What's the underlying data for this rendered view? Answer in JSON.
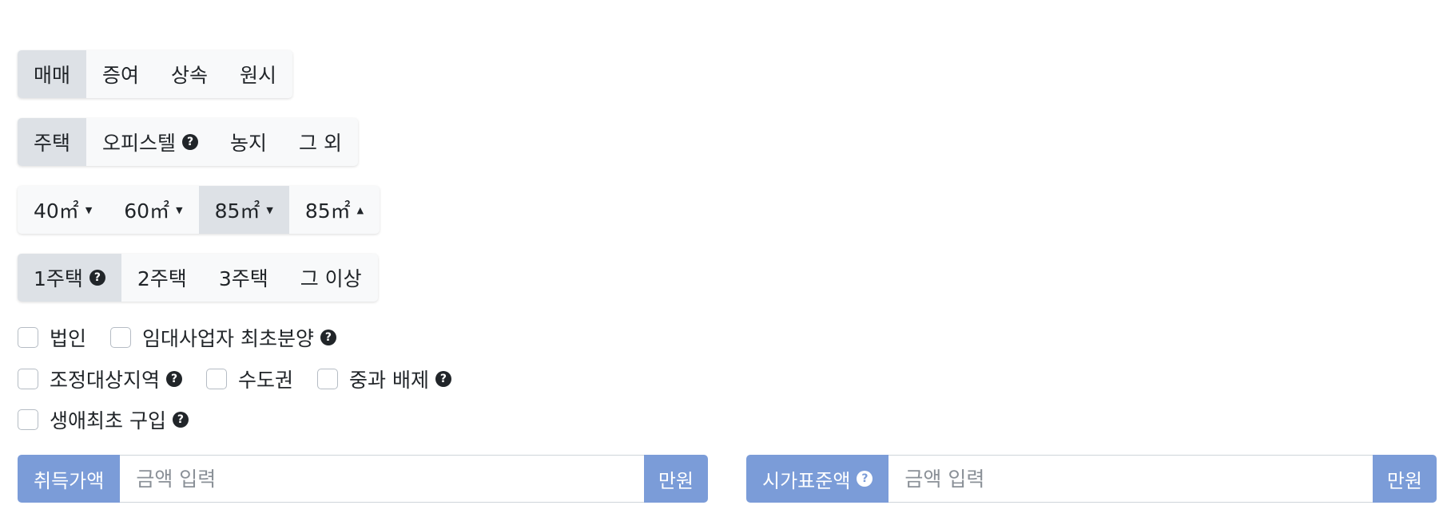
{
  "trade_types": [
    "매매",
    "증여",
    "상속",
    "원시"
  ],
  "property_types": [
    "주택",
    "오피스텔",
    "농지",
    "그 외"
  ],
  "areas": [
    {
      "label": "40㎡",
      "caret": "▼"
    },
    {
      "label": "60㎡",
      "caret": "▼"
    },
    {
      "label": "85㎡",
      "caret": "▼"
    },
    {
      "label": "85㎡",
      "caret": "▲"
    }
  ],
  "house_counts": [
    "1주택",
    "2주택",
    "3주택",
    "그 이상"
  ],
  "checkboxes": {
    "corporation": "법인",
    "rental_first_sale": "임대사업자 최초분양",
    "regulated_area": "조정대상지역",
    "capital_area": "수도권",
    "exclude_surcharge": "중과 배제",
    "first_purchase": "생애최초 구입"
  },
  "help_icon_glyph": "?",
  "acquisition": {
    "label": "취득가액",
    "placeholder": "금액 입력",
    "unit": "만원"
  },
  "standard_price": {
    "label": "시가표준액",
    "placeholder": "금액 입력",
    "unit": "만원"
  },
  "colors": {
    "accent": "#7b9cd8",
    "active_segment": "#dde1e6",
    "segment_bg": "#f8f9fa"
  }
}
